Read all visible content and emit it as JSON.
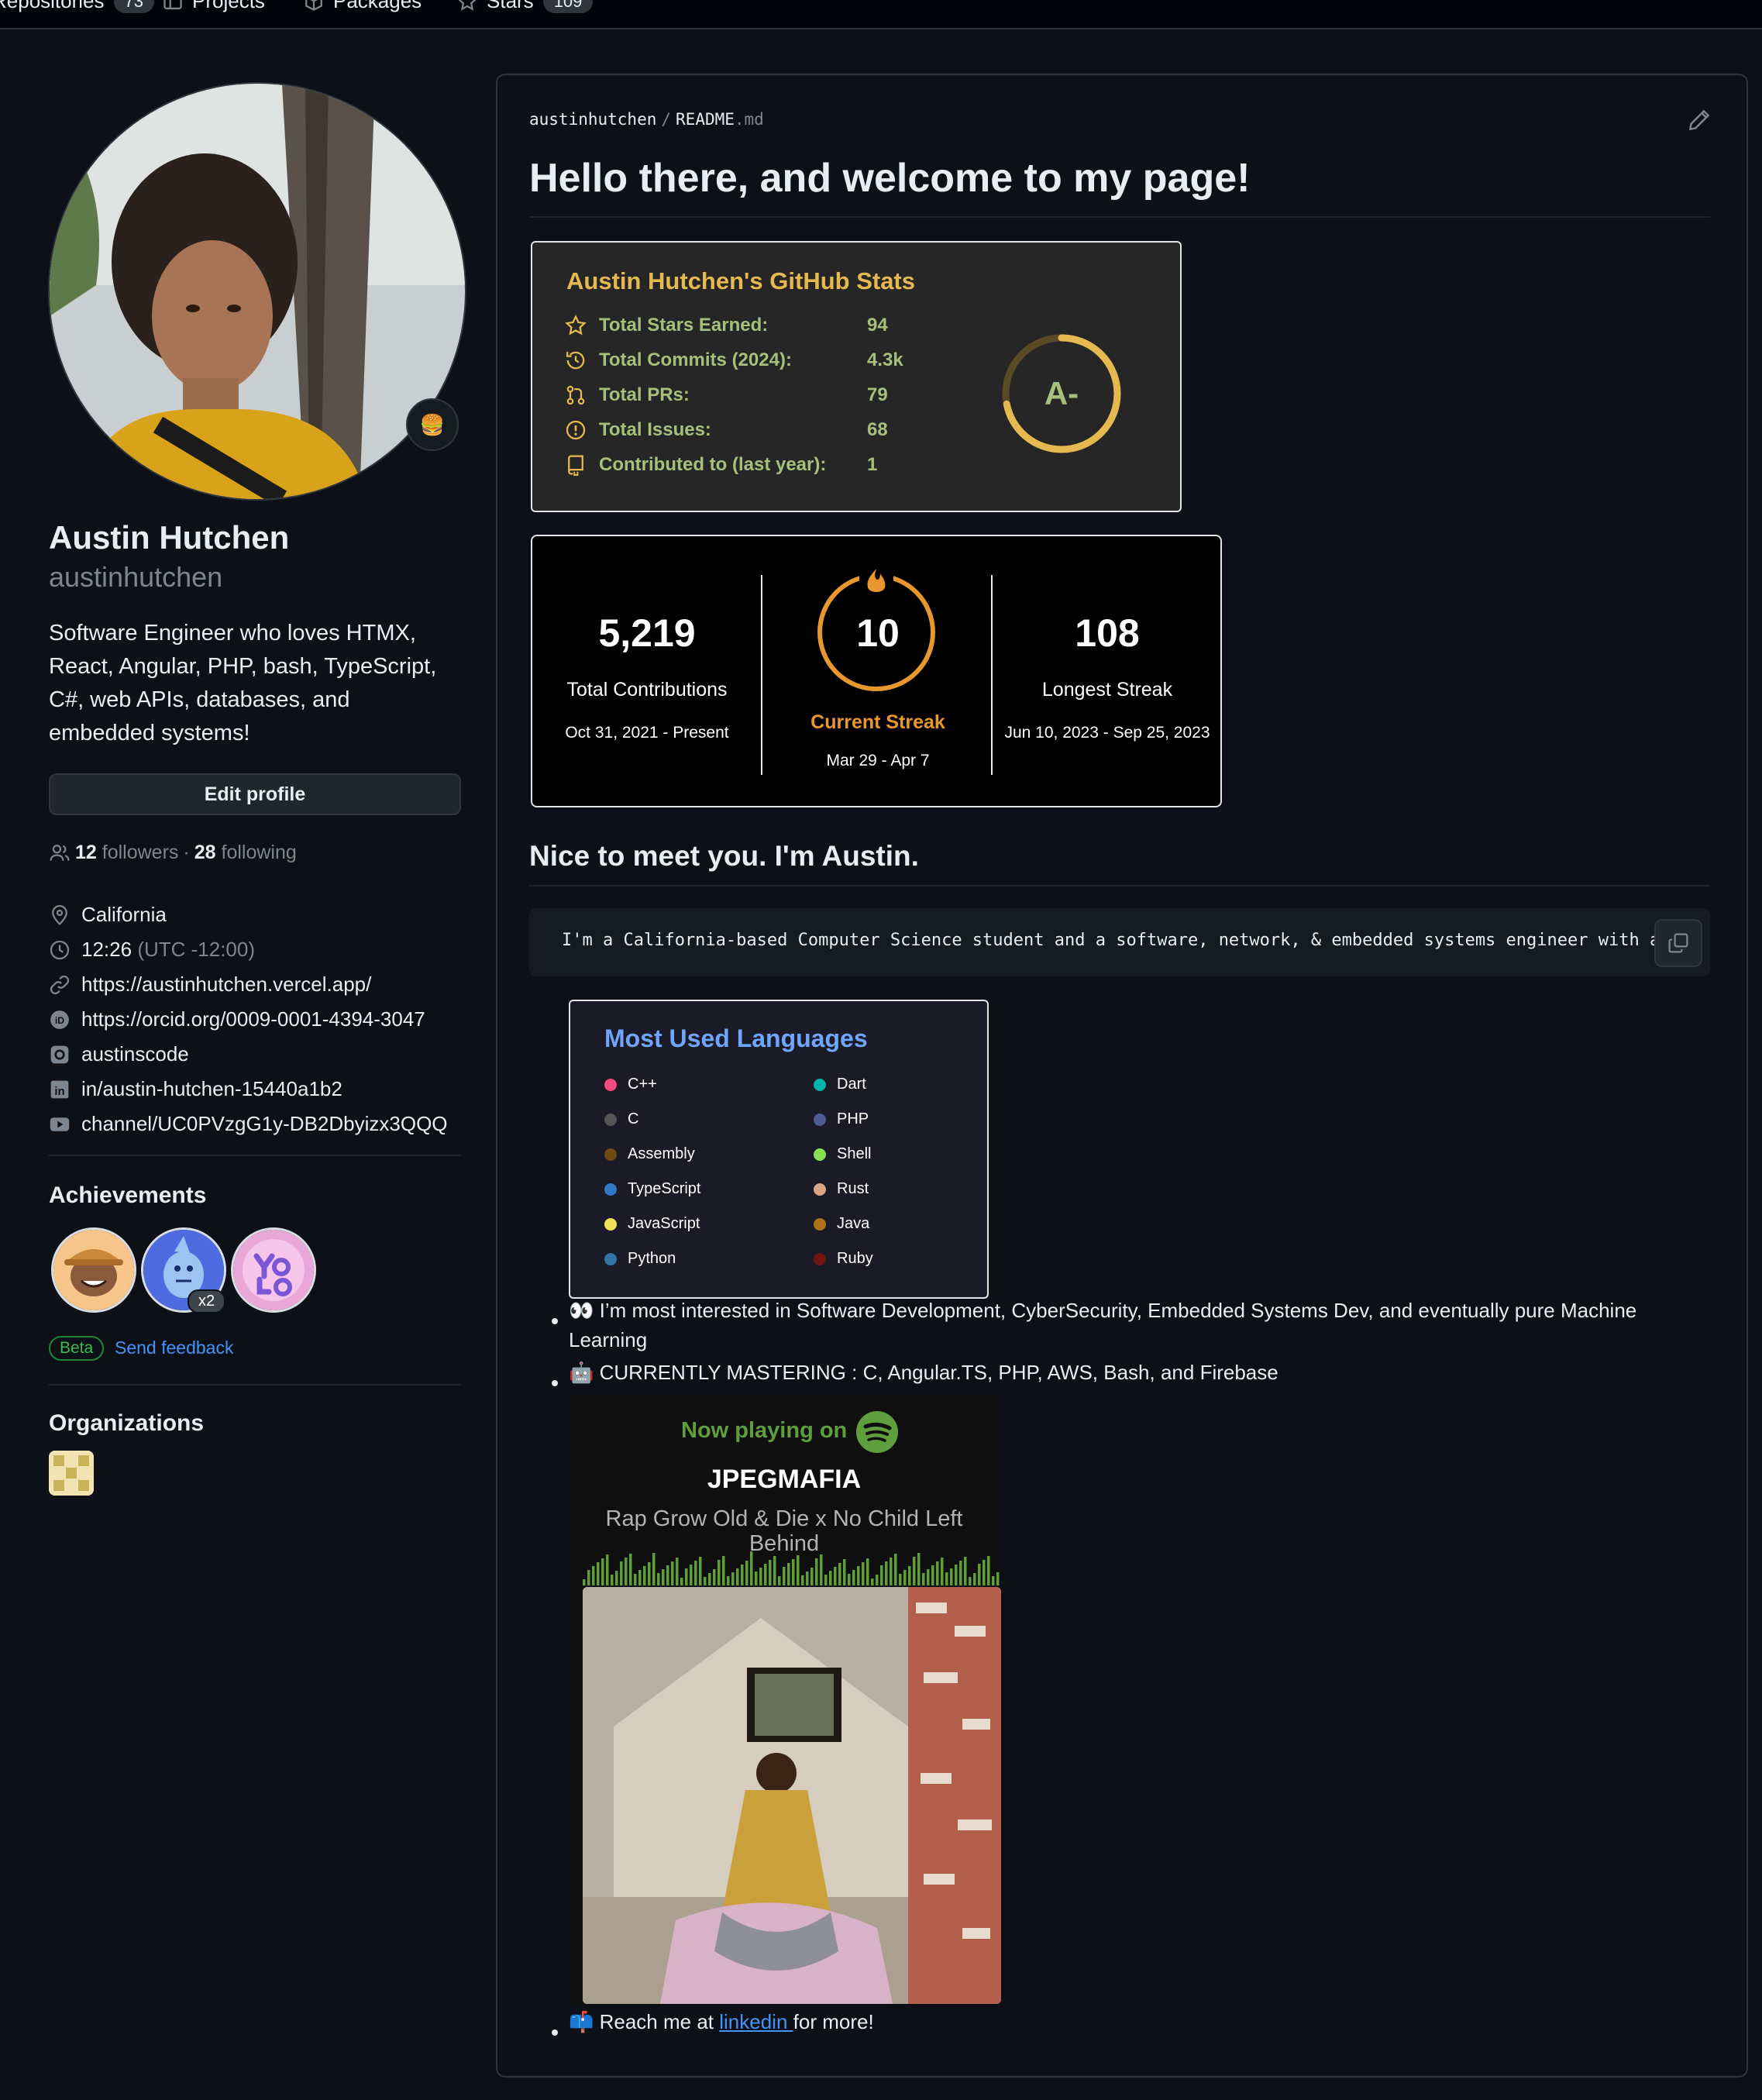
{
  "nav": {
    "tabs": [
      {
        "label": "Repositories",
        "count": "73"
      },
      {
        "label": "Projects"
      },
      {
        "label": "Packages"
      },
      {
        "label": "Stars",
        "count": "109"
      }
    ]
  },
  "profile": {
    "status_emoji": "🍔",
    "name": "Austin Hutchen",
    "login": "austinhutchen",
    "bio": "Software Engineer who loves HTMX, React, Angular, PHP, bash, TypeScript, C#, web APIs, databases, and embedded systems!",
    "edit_label": "Edit profile",
    "followers": "12",
    "followers_label": "followers",
    "separator": "·",
    "following": "28",
    "following_label": "following",
    "location": "California",
    "time": "12:26",
    "timezone": "(UTC -12:00)",
    "website": "https://austinhutchen.vercel.app/",
    "orcid": "https://orcid.org/0009-0001-4394-3047",
    "instagram": "austinscode",
    "linkedin": "in/austin-hutchen-15440a1b2",
    "youtube": "channel/UC0PVzgG1y-DB2Dbyizx3QQQ"
  },
  "achievements": {
    "title": "Achievements",
    "multiplier": "x2",
    "beta_label": "Beta",
    "feedback_label": "Send feedback"
  },
  "organizations": {
    "title": "Organizations"
  },
  "readme": {
    "path_owner": "austinhutchen",
    "path_sep": "/",
    "path_file": "README",
    "path_ext": ".md",
    "heading": "Hello there, and welcome to my page!",
    "subheading": "Nice to meet you. I'm Austin.",
    "code_text": "I'm a California-based Computer Science student and a software, network, & embedded systems engineer with a lo",
    "bullet1": "👀 I’m most interested in Software Development, CyberSecurity, Embedded Systems Dev, and eventually pure Machine Learning",
    "bullet2": "🤖 CURRENTLY MASTERING : C, Angular.TS, PHP, AWS, Bash, and Firebase",
    "bullet3_prefix": "📫 Reach me at ",
    "bullet3_link": "linkedin ",
    "bullet3_suffix": "for more!"
  },
  "stats": {
    "title": "Austin Hutchen's GitHub Stats",
    "rows": [
      {
        "label": "Total Stars Earned:",
        "value": "94"
      },
      {
        "label": "Total Commits (2024):",
        "value": "4.3k"
      },
      {
        "label": "Total PRs:",
        "value": "79"
      },
      {
        "label": "Total Issues:",
        "value": "68"
      },
      {
        "label": "Contributed to (last year):",
        "value": "1"
      }
    ],
    "grade": "A-",
    "grade_progress": 0.72,
    "colors": {
      "title": "#e5b94f",
      "text": "#a6c07c",
      "ring": "#e5b94f"
    }
  },
  "streak": {
    "total": "5,219",
    "total_label": "Total Contributions",
    "total_range": "Oct 31, 2021 - Present",
    "current": "10",
    "current_label": "Current Streak",
    "current_range": "Mar 29 - Apr 7",
    "longest": "108",
    "longest_label": "Longest Streak",
    "longest_range": "Jun 10, 2023 - Sep 25, 2023",
    "accent": "#e8962e"
  },
  "languages": {
    "title": "Most Used Languages",
    "left": [
      {
        "name": "C++",
        "color": "#f34b7d"
      },
      {
        "name": "C",
        "color": "#555555"
      },
      {
        "name": "Assembly",
        "color": "#6e4c13"
      },
      {
        "name": "TypeScript",
        "color": "#3178c6"
      },
      {
        "name": "JavaScript",
        "color": "#f1e05a"
      },
      {
        "name": "Python",
        "color": "#3572A5"
      }
    ],
    "right": [
      {
        "name": "Dart",
        "color": "#00B4AB"
      },
      {
        "name": "PHP",
        "color": "#4F5D95"
      },
      {
        "name": "Shell",
        "color": "#89e051"
      },
      {
        "name": "Rust",
        "color": "#dea584"
      },
      {
        "name": "Java",
        "color": "#b07219"
      },
      {
        "name": "Ruby",
        "color": "#701516"
      }
    ]
  },
  "spotify": {
    "now_playing": "Now playing on",
    "artist": "JPEGMAFIA",
    "song": "Rap Grow Old & Die x No Child Left Behind",
    "accent": "#1DB954"
  }
}
